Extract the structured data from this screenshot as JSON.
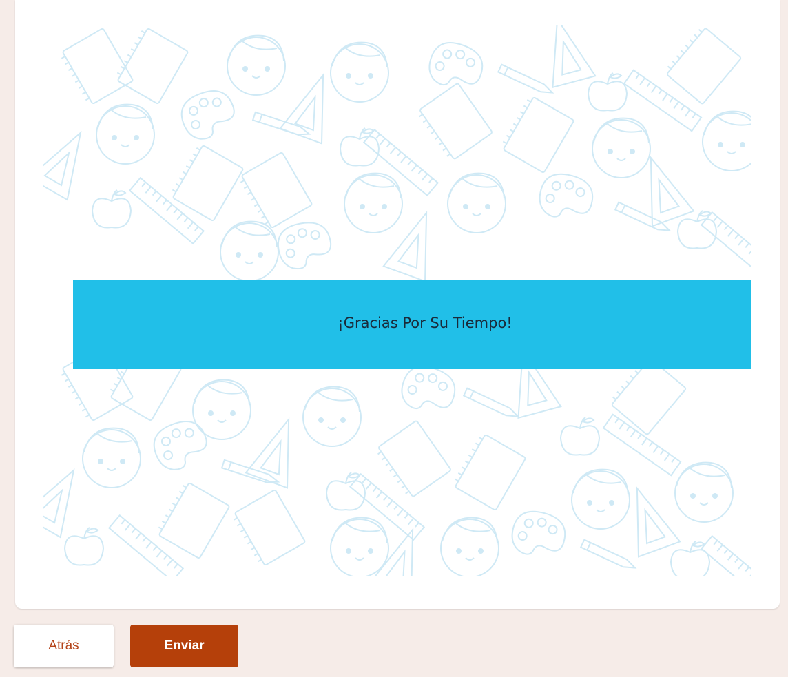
{
  "form": {
    "thank_you_text": "¡Gracias Por Su Tiempo!"
  },
  "footer": {
    "back_label": "Atrás",
    "submit_label": "Enviar"
  },
  "colors": {
    "page_background": "#f6ece8",
    "banner": "#21bfe8",
    "accent": "#b5400a",
    "pattern_line": "#cfe9f5"
  },
  "icons": [
    "girl-face-icon",
    "palette-icon",
    "notebook-icon",
    "ruler-icon",
    "pencil-icon",
    "set-square-icon",
    "apple-icon"
  ]
}
